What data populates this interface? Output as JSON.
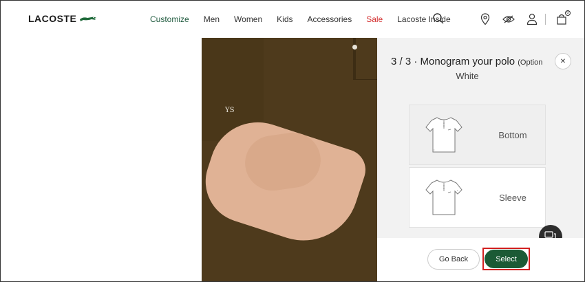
{
  "brand": {
    "logo_text": "LACOSTE"
  },
  "nav": {
    "items": [
      {
        "label": "Customize"
      },
      {
        "label": "Men"
      },
      {
        "label": "Women"
      },
      {
        "label": "Kids"
      },
      {
        "label": "Accessories"
      },
      {
        "label": "Sale"
      },
      {
        "label": "Lacoste Inside"
      }
    ]
  },
  "header_icons": {
    "search": "search-icon",
    "store": "location-pin-icon",
    "wishlist": "eye-icon",
    "account": "user-icon",
    "cart": "shopping-bag-icon",
    "cart_count": "0"
  },
  "product": {
    "monogram_text": "YS",
    "polo_color": "#4e3a1c"
  },
  "panel": {
    "title": "3 / 3 · Monogram your polo",
    "title_suffix": "(Option",
    "subtitle": "White",
    "options": [
      {
        "label": "Bottom"
      },
      {
        "label": "Sleeve"
      }
    ],
    "go_back_label": "Go Back",
    "select_label": "Select"
  },
  "colors": {
    "accent_green": "#1b5a35",
    "sale_red": "#d32f2f",
    "highlight_red": "#d32020"
  }
}
